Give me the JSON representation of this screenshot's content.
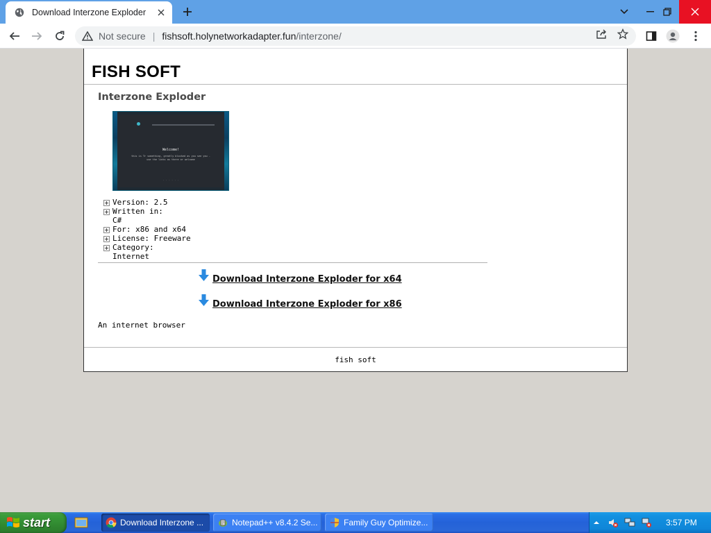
{
  "browser": {
    "tab_title": "Download Interzone Exploder",
    "address": {
      "security_label": "Not secure",
      "host": "fishsoft.holynetworkadapter.fun",
      "path": "/interzone/"
    }
  },
  "page": {
    "site_title": "FISH SOFT",
    "product_title": "Interzone Exploder",
    "screenshot": {
      "welcome": "Welcome!",
      "subtitle": "this is Tr something, greatly blocked as you see you - use the links as there or welcome"
    },
    "specs": [
      {
        "text": "Version: 2.5",
        "cont": ""
      },
      {
        "text": "Written in:",
        "cont": "C#"
      },
      {
        "text": "For: x86 and x64",
        "cont": ""
      },
      {
        "text": "License: Freeware",
        "cont": ""
      },
      {
        "text": "Category:",
        "cont": "Internet"
      }
    ],
    "downloads": {
      "x64": "Download Interzone Exploder for x64",
      "x86": "Download Interzone Exploder for x86"
    },
    "description": "An internet browser",
    "footer": "fish soft"
  },
  "taskbar": {
    "start_label": "start",
    "tasks": [
      {
        "label": "Download Interzone ...",
        "icon": "chrome-icon"
      },
      {
        "label": "Notepad++ v8.4.2 Se...",
        "icon": "notepadpp-icon"
      },
      {
        "label": "Family Guy Optimize...",
        "icon": "shield-icon"
      }
    ],
    "clock": "3:57 PM"
  },
  "colors": {
    "tabstrip": "#5fa1e6",
    "taskbar": "#2462d8",
    "start_button": "#318a31",
    "page_bg": "#d6d3ce",
    "download_arrow": "#2a8ae0"
  }
}
